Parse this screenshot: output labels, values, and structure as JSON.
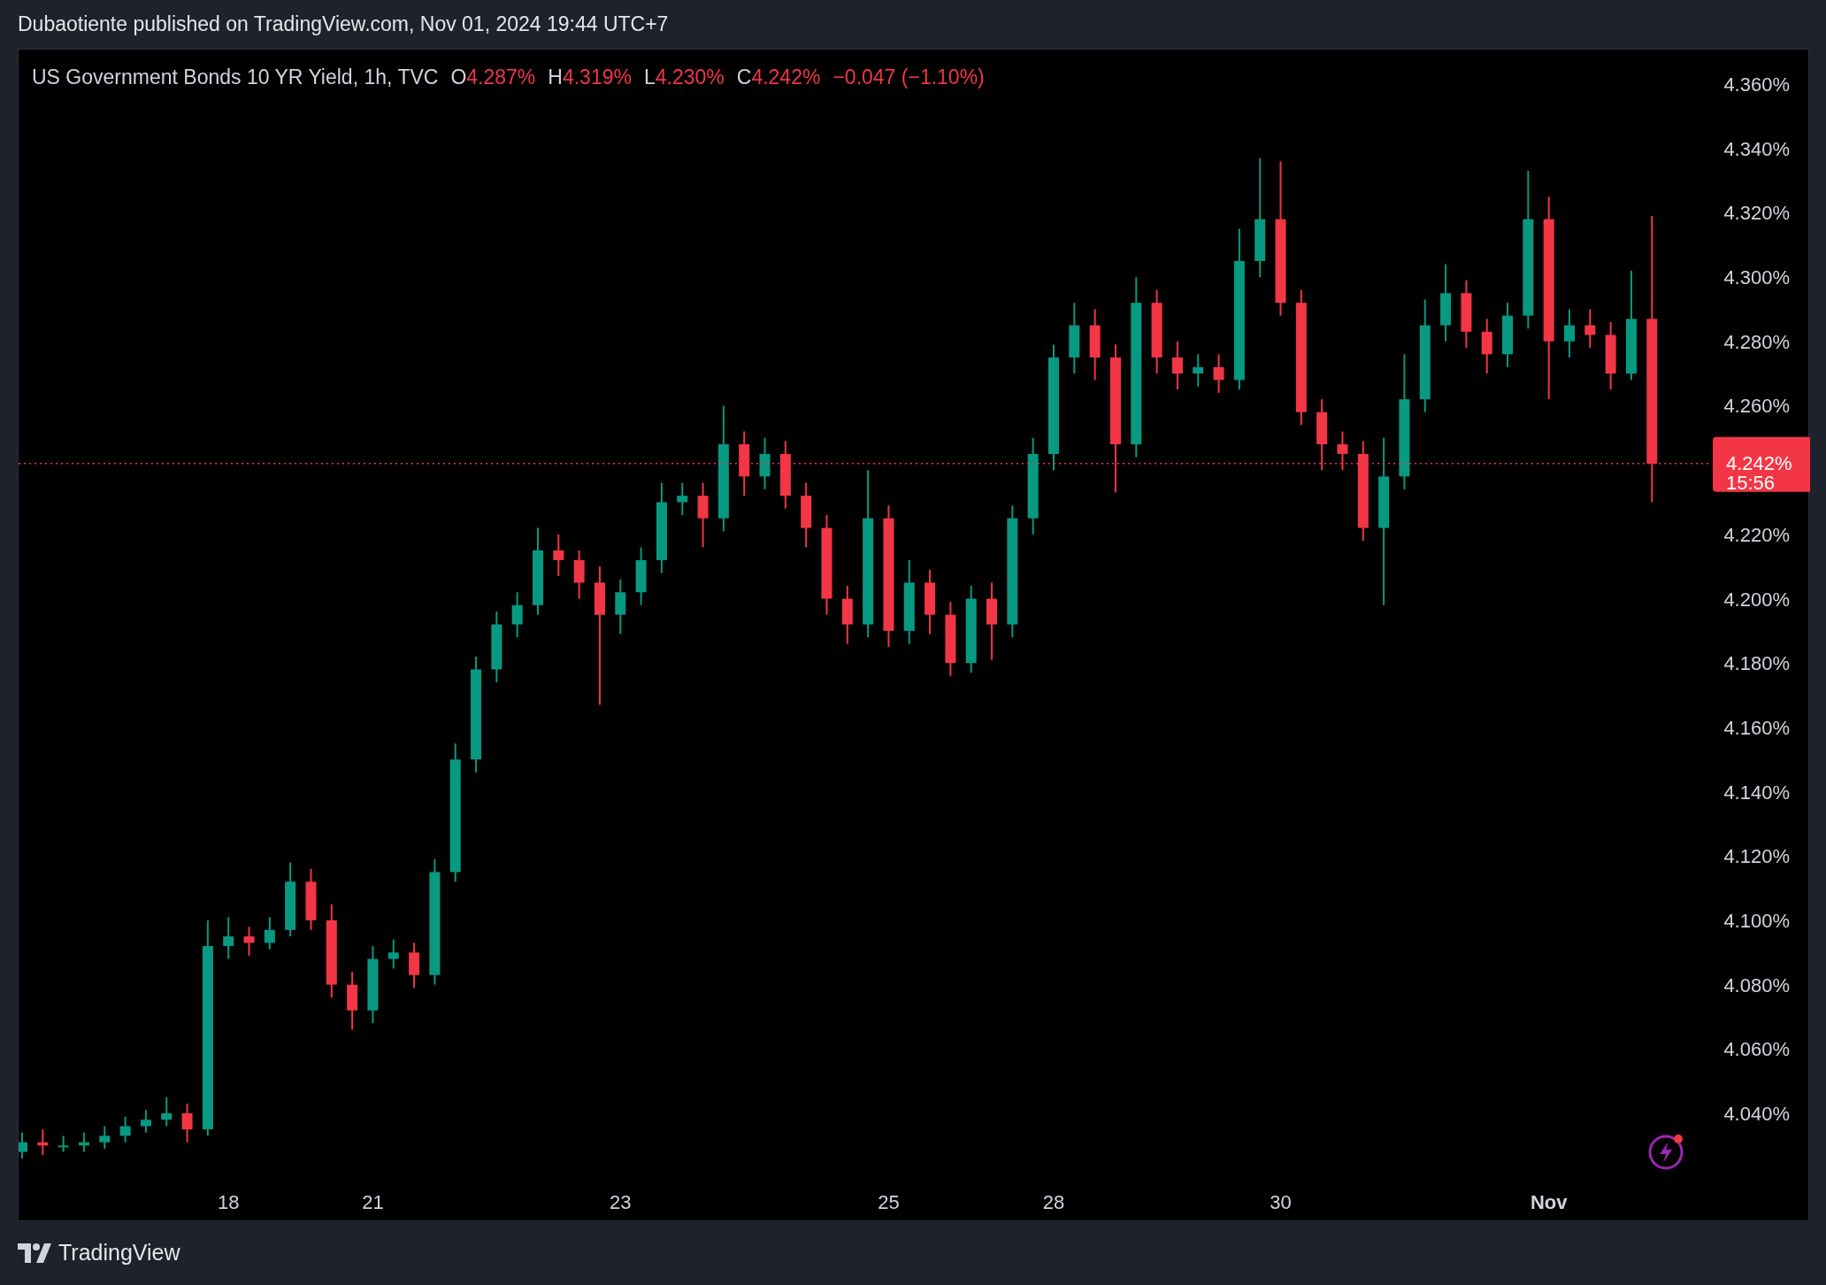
{
  "header": {
    "text": "Dubaotiente published on TradingView.com, Nov 01, 2024 19:44 UTC+7"
  },
  "legend": {
    "symbol": "US Government Bonds 10 YR Yield, 1h, TVC",
    "values": [
      {
        "label": "O",
        "value": "4.287%"
      },
      {
        "label": "H",
        "value": "4.319%"
      },
      {
        "label": "L",
        "value": "4.230%"
      },
      {
        "label": "C",
        "value": "4.242%"
      }
    ],
    "change": "−0.047 (−1.10%)"
  },
  "chart": {
    "chart_data": {
      "type": "candlestick",
      "categories": [
        null,
        null,
        null,
        null,
        null,
        null,
        null,
        null,
        null,
        null,
        "18",
        null,
        null,
        null,
        null,
        null,
        null,
        "21",
        null,
        null,
        null,
        null,
        null,
        null,
        null,
        null,
        null,
        null,
        null,
        "23",
        null,
        null,
        null,
        null,
        null,
        null,
        null,
        null,
        null,
        null,
        null,
        null,
        "25",
        null,
        null,
        null,
        null,
        null,
        null,
        null,
        "28",
        null,
        null,
        null,
        null,
        null,
        null,
        null,
        null,
        null,
        null,
        "30",
        null,
        null,
        null,
        null,
        null,
        null,
        null,
        null,
        null,
        null,
        null,
        null,
        "Nov",
        null,
        null,
        null,
        null,
        null
      ],
      "ohlc": [
        [
          4.028,
          4.034,
          4.026,
          4.031
        ],
        [
          4.031,
          4.035,
          4.027,
          4.03
        ],
        [
          4.03,
          4.033,
          4.028,
          4.03
        ],
        [
          4.03,
          4.034,
          4.028,
          4.031
        ],
        [
          4.031,
          4.036,
          4.029,
          4.033
        ],
        [
          4.033,
          4.039,
          4.031,
          4.036
        ],
        [
          4.036,
          4.041,
          4.034,
          4.038
        ],
        [
          4.038,
          4.045,
          4.036,
          4.04
        ],
        [
          4.04,
          4.043,
          4.031,
          4.035
        ],
        [
          4.035,
          4.1,
          4.033,
          4.092
        ],
        [
          4.092,
          4.101,
          4.088,
          4.095
        ],
        [
          4.095,
          4.098,
          4.089,
          4.093
        ],
        [
          4.093,
          4.101,
          4.091,
          4.097
        ],
        [
          4.097,
          4.118,
          4.095,
          4.112
        ],
        [
          4.112,
          4.116,
          4.097,
          4.1
        ],
        [
          4.1,
          4.105,
          4.076,
          4.08
        ],
        [
          4.08,
          4.084,
          4.066,
          4.072
        ],
        [
          4.072,
          4.092,
          4.068,
          4.088
        ],
        [
          4.088,
          4.094,
          4.085,
          4.09
        ],
        [
          4.09,
          4.093,
          4.079,
          4.083
        ],
        [
          4.083,
          4.119,
          4.08,
          4.115
        ],
        [
          4.115,
          4.155,
          4.112,
          4.15
        ],
        [
          4.15,
          4.182,
          4.146,
          4.178
        ],
        [
          4.178,
          4.196,
          4.174,
          4.192
        ],
        [
          4.192,
          4.202,
          4.188,
          4.198
        ],
        [
          4.198,
          4.222,
          4.195,
          4.215
        ],
        [
          4.215,
          4.22,
          4.207,
          4.212
        ],
        [
          4.212,
          4.215,
          4.2,
          4.205
        ],
        [
          4.205,
          4.21,
          4.167,
          4.195
        ],
        [
          4.195,
          4.206,
          4.189,
          4.202
        ],
        [
          4.202,
          4.216,
          4.198,
          4.212
        ],
        [
          4.212,
          4.236,
          4.208,
          4.23
        ],
        [
          4.23,
          4.236,
          4.226,
          4.232
        ],
        [
          4.232,
          4.236,
          4.216,
          4.225
        ],
        [
          4.225,
          4.26,
          4.221,
          4.248
        ],
        [
          4.248,
          4.252,
          4.232,
          4.238
        ],
        [
          4.238,
          4.25,
          4.234,
          4.245
        ],
        [
          4.245,
          4.249,
          4.228,
          4.232
        ],
        [
          4.232,
          4.236,
          4.216,
          4.222
        ],
        [
          4.222,
          4.226,
          4.195,
          4.2
        ],
        [
          4.2,
          4.204,
          4.186,
          4.192
        ],
        [
          4.192,
          4.24,
          4.188,
          4.225
        ],
        [
          4.225,
          4.229,
          4.185,
          4.19
        ],
        [
          4.19,
          4.212,
          4.186,
          4.205
        ],
        [
          4.205,
          4.209,
          4.189,
          4.195
        ],
        [
          4.195,
          4.199,
          4.176,
          4.18
        ],
        [
          4.18,
          4.204,
          4.177,
          4.2
        ],
        [
          4.2,
          4.205,
          4.181,
          4.192
        ],
        [
          4.192,
          4.229,
          4.188,
          4.225
        ],
        [
          4.225,
          4.25,
          4.22,
          4.245
        ],
        [
          4.245,
          4.279,
          4.24,
          4.275
        ],
        [
          4.275,
          4.292,
          4.27,
          4.285
        ],
        [
          4.285,
          4.29,
          4.268,
          4.275
        ],
        [
          4.275,
          4.279,
          4.233,
          4.248
        ],
        [
          4.248,
          4.3,
          4.244,
          4.292
        ],
        [
          4.292,
          4.296,
          4.27,
          4.275
        ],
        [
          4.275,
          4.28,
          4.265,
          4.27
        ],
        [
          4.27,
          4.276,
          4.266,
          4.272
        ],
        [
          4.272,
          4.276,
          4.264,
          4.268
        ],
        [
          4.268,
          4.315,
          4.265,
          4.305
        ],
        [
          4.305,
          4.337,
          4.3,
          4.318
        ],
        [
          4.318,
          4.336,
          4.288,
          4.292
        ],
        [
          4.292,
          4.296,
          4.254,
          4.258
        ],
        [
          4.258,
          4.262,
          4.24,
          4.248
        ],
        [
          4.248,
          4.252,
          4.24,
          4.245
        ],
        [
          4.245,
          4.249,
          4.218,
          4.222
        ],
        [
          4.222,
          4.25,
          4.198,
          4.238
        ],
        [
          4.238,
          4.276,
          4.234,
          4.262
        ],
        [
          4.262,
          4.293,
          4.258,
          4.285
        ],
        [
          4.285,
          4.304,
          4.28,
          4.295
        ],
        [
          4.295,
          4.299,
          4.278,
          4.283
        ],
        [
          4.283,
          4.287,
          4.27,
          4.276
        ],
        [
          4.276,
          4.292,
          4.272,
          4.288
        ],
        [
          4.288,
          4.333,
          4.284,
          4.318
        ],
        [
          4.318,
          4.325,
          4.262,
          4.28
        ],
        [
          4.28,
          4.29,
          4.275,
          4.285
        ],
        [
          4.285,
          4.29,
          4.278,
          4.282
        ],
        [
          4.282,
          4.286,
          4.265,
          4.27
        ],
        [
          4.27,
          4.302,
          4.268,
          4.287
        ],
        [
          4.287,
          4.319,
          4.23,
          4.242
        ]
      ],
      "ylim": [
        4.04,
        4.36
      ],
      "ref_lines": [
        {
          "axis": "y",
          "value": 4.242,
          "label": "4.242%"
        }
      ],
      "yticks": [
        {
          "value": 4.04,
          "label": "4.040%"
        },
        {
          "value": 4.06,
          "label": "4.060%"
        },
        {
          "value": 4.08,
          "label": "4.080%"
        },
        {
          "value": 4.1,
          "label": "4.100%"
        },
        {
          "value": 4.12,
          "label": "4.120%"
        },
        {
          "value": 4.14,
          "label": "4.140%"
        },
        {
          "value": 4.16,
          "label": "4.160%"
        },
        {
          "value": 4.18,
          "label": "4.180%"
        },
        {
          "value": 4.2,
          "label": "4.200%"
        },
        {
          "value": 4.22,
          "label": "4.220%"
        },
        {
          "value": 4.26,
          "label": "4.260%"
        },
        {
          "value": 4.28,
          "label": "4.280%"
        },
        {
          "value": 4.3,
          "label": "4.300%"
        },
        {
          "value": 4.32,
          "label": "4.320%"
        },
        {
          "value": 4.34,
          "label": "4.340%"
        },
        {
          "value": 4.36,
          "label": "4.360%"
        }
      ]
    },
    "last_price": {
      "countdown": "15:56"
    }
  },
  "footer": {
    "brand": "TradingView"
  }
}
